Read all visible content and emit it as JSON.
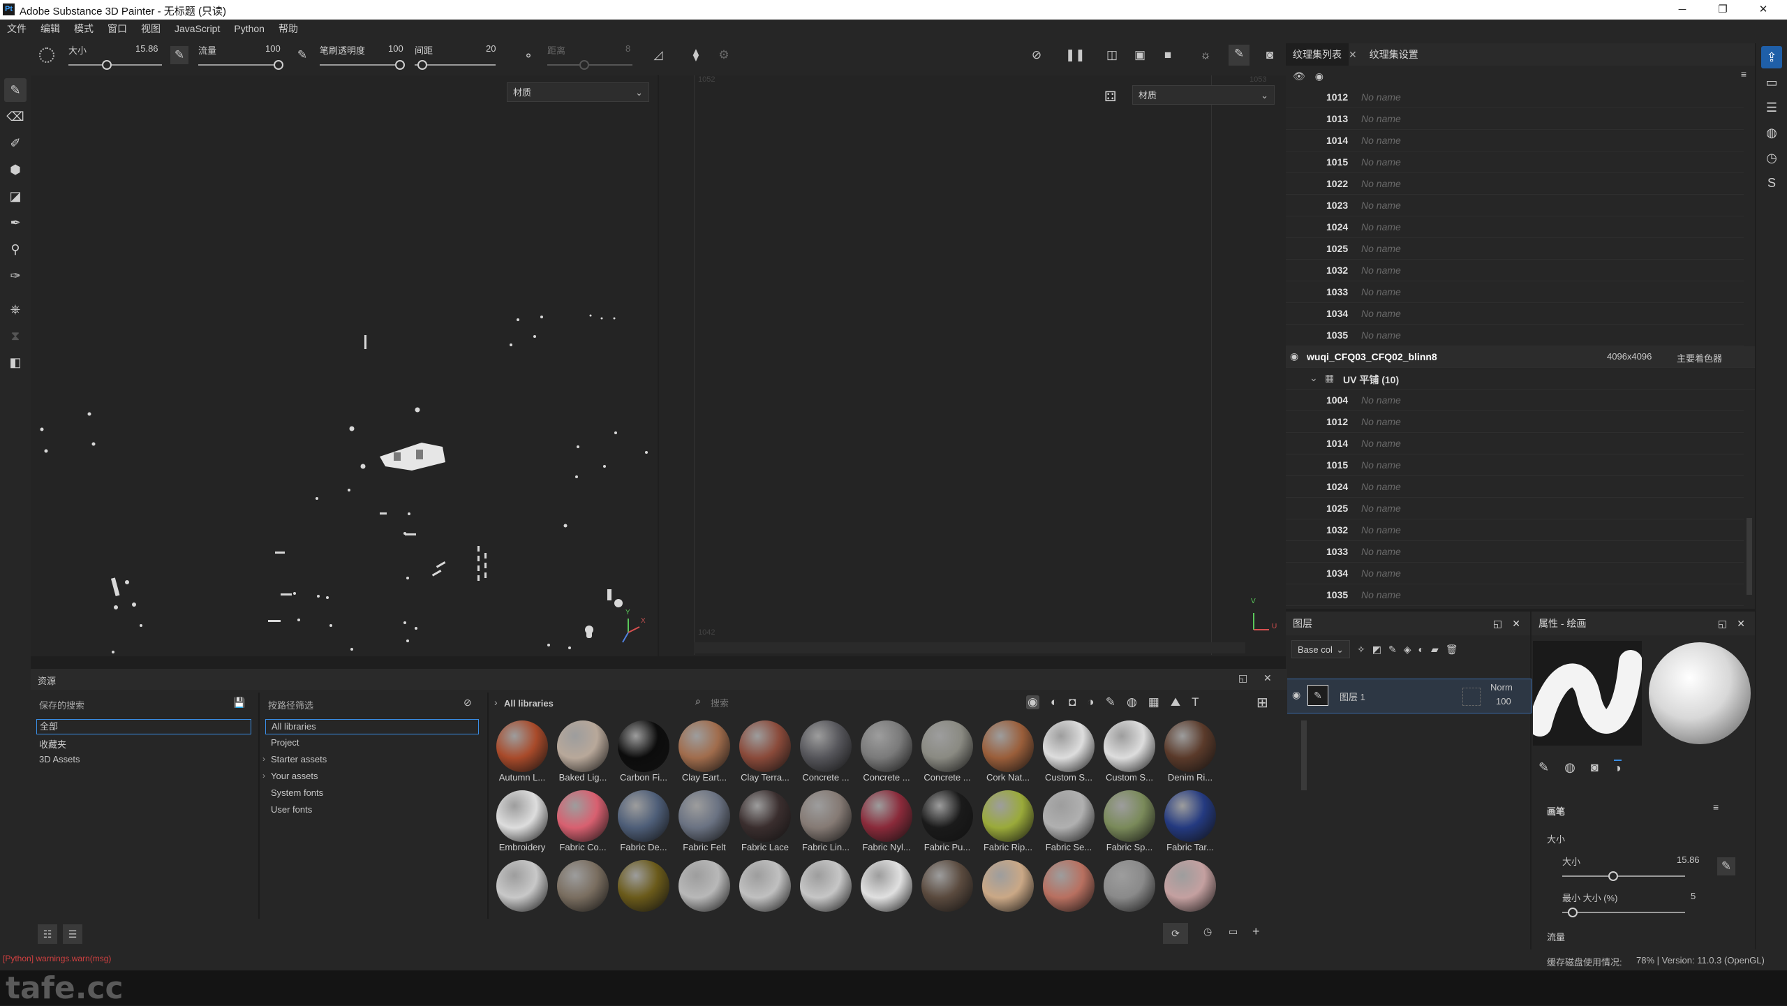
{
  "window": {
    "title": "Adobe Substance 3D Painter - 无标题 (只读)",
    "logo": "Pt",
    "controls": [
      "─",
      "❐",
      "✕"
    ]
  },
  "menu": [
    "文件",
    "编辑",
    "模式",
    "窗口",
    "视图",
    "JavaScript",
    "Python",
    "帮助"
  ],
  "toolbar": {
    "size_label": "大小",
    "size_value": "15.86",
    "flow_label": "流量",
    "flow_value": "100",
    "opacity_label": "笔刷透明度",
    "opacity_value": "100",
    "spacing_label": "间距",
    "spacing_value": "20",
    "distance_label": "距离",
    "distance_value": "8"
  },
  "viewport": {
    "left_dropdown": "材质",
    "right_dropdown": "材质",
    "ruler_a": "1052",
    "ruler_b": "1053",
    "ruler_c": "1042",
    "uv_axis_v": "V",
    "uv_axis_u": "U",
    "xyz_x": "X",
    "xyz_y": "Y"
  },
  "texture_sets": {
    "tab_list": "纹理集列表",
    "tab_settings": "纹理集设置",
    "group1_rows": [
      {
        "udim": "1012",
        "name": "No name"
      },
      {
        "udim": "1013",
        "name": "No name"
      },
      {
        "udim": "1014",
        "name": "No name"
      },
      {
        "udim": "1015",
        "name": "No name"
      },
      {
        "udim": "1022",
        "name": "No name"
      },
      {
        "udim": "1023",
        "name": "No name"
      },
      {
        "udim": "1024",
        "name": "No name"
      },
      {
        "udim": "1025",
        "name": "No name"
      },
      {
        "udim": "1032",
        "name": "No name"
      },
      {
        "udim": "1033",
        "name": "No name"
      },
      {
        "udim": "1034",
        "name": "No name"
      },
      {
        "udim": "1035",
        "name": "No name"
      }
    ],
    "set_name": "wuqi_CFQ03_CFQ02_blinn8",
    "set_resolution": "4096x4096",
    "set_shader": "主要着色器",
    "uv_tiles_label": "UV 平铺 (10)",
    "group2_rows": [
      {
        "udim": "1004",
        "name": "No name"
      },
      {
        "udim": "1012",
        "name": "No name"
      },
      {
        "udim": "1014",
        "name": "No name"
      },
      {
        "udim": "1015",
        "name": "No name"
      },
      {
        "udim": "1024",
        "name": "No name"
      },
      {
        "udim": "1025",
        "name": "No name"
      },
      {
        "udim": "1032",
        "name": "No name"
      },
      {
        "udim": "1033",
        "name": "No name"
      },
      {
        "udim": "1034",
        "name": "No name"
      },
      {
        "udim": "1035",
        "name": "No name"
      }
    ]
  },
  "layers": {
    "title": "图层",
    "channel": "Base col",
    "layer_name": "图层 1",
    "blend": "Norm",
    "opacity": "100"
  },
  "properties": {
    "title": "属性 - 绘画",
    "section": "画笔",
    "size_group": "大小",
    "size_label": "大小",
    "size_value": "15.86",
    "min_size_label": "最小 大小 (%)",
    "min_size_value": "5",
    "flow_label": "流量"
  },
  "assets": {
    "title": "资源",
    "saved_search_label": "保存的搜索",
    "filter_label": "按路径筛选",
    "saved_items": [
      "全部",
      "收藏夹",
      "3D Assets"
    ],
    "libraries": [
      "All libraries",
      "Project",
      "Starter assets",
      "Your assets",
      "System fonts",
      "User fonts"
    ],
    "breadcrumb": "All libraries",
    "search_placeholder": "搜索",
    "row1": [
      {
        "label": "Autumn L...",
        "color": "#a84a2a"
      },
      {
        "label": "Baked Lig...",
        "color": "#b8a89a"
      },
      {
        "label": "Carbon Fi...",
        "color": "#0c0c0c"
      },
      {
        "label": "Clay Eart...",
        "color": "#a06c4c"
      },
      {
        "label": "Clay Terra...",
        "color": "#8a4a3a"
      },
      {
        "label": "Concrete ...",
        "color": "#55555a"
      },
      {
        "label": "Concrete ...",
        "color": "#7a7a7a"
      },
      {
        "label": "Concrete ...",
        "color": "#8a8a82"
      },
      {
        "label": "Cork Nat...",
        "color": "#9a5e3a"
      },
      {
        "label": "Custom S...",
        "color": "#dddddd"
      },
      {
        "label": "Custom S...",
        "color": "#dddddd"
      },
      {
        "label": "Denim Ri...",
        "color": "#5a3a2a"
      }
    ],
    "row2": [
      {
        "label": "Embroidery",
        "color": "#dddddd"
      },
      {
        "label": "Fabric Co...",
        "color": "#d86070"
      },
      {
        "label": "Fabric De...",
        "color": "#4e5e78"
      },
      {
        "label": "Fabric Felt",
        "color": "#6a7282"
      },
      {
        "label": "Fabric Lace",
        "color": "#3a2e2e"
      },
      {
        "label": "Fabric Lin...",
        "color": "#857a74"
      },
      {
        "label": "Fabric Nyl...",
        "color": "#8a2a3a"
      },
      {
        "label": "Fabric Pu...",
        "color": "#1a1a1a"
      },
      {
        "label": "Fabric Rip...",
        "color": "#9aaa3a"
      },
      {
        "label": "Fabric Se...",
        "color": "#b0b0b0"
      },
      {
        "label": "Fabric Sp...",
        "color": "#7a8a5a"
      },
      {
        "label": "Fabric Tar...",
        "color": "#243a80"
      }
    ],
    "row3": [
      {
        "color": "#c8c8c8"
      },
      {
        "color": "#7a6e60"
      },
      {
        "color": "#6a5a1a"
      },
      {
        "color": "#b8b8b8"
      },
      {
        "color": "#c0c0c0"
      },
      {
        "color": "#c6c6c6"
      },
      {
        "color": "#e0e0e0"
      },
      {
        "color": "#5a4a3e"
      },
      {
        "color": "#caa886"
      },
      {
        "color": "#b87060"
      },
      {
        "color": "#8a8a8a"
      },
      {
        "color": "#c4a0a0"
      }
    ]
  },
  "status": {
    "error": "[Python] warnings.warn(msg)",
    "cache": "缓存磁盘使用情况:",
    "info": "78% | Version: 11.0.3 (OpenGL)"
  },
  "watermark": "tafe.cc",
  "colors": {
    "accent": "#3a8ee6",
    "panel": "#262626",
    "viewport": "#242424"
  }
}
